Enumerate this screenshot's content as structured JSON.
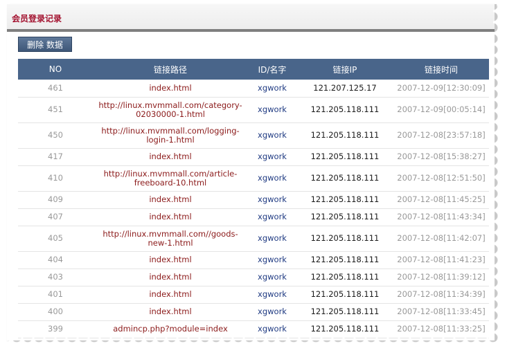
{
  "page": {
    "title": "会员登录记录",
    "delete_button": "删除 数据"
  },
  "table": {
    "headers": [
      "NO",
      "链接路径",
      "ID/名字",
      "链接IP",
      "链接时间"
    ],
    "rows": [
      {
        "no": "461",
        "path": "index.html",
        "name": "xgwork",
        "ip": "121.207.125.17",
        "time": "2007-12-09[12:30:09]"
      },
      {
        "no": "451",
        "path": "http://linux.mvmmall.com/category-02030000-1.html",
        "name": "xgwork",
        "ip": "121.205.118.111",
        "time": "2007-12-09[00:05:14]"
      },
      {
        "no": "450",
        "path": "http://linux.mvmmall.com/logging-login-1.html",
        "name": "xgwork",
        "ip": "121.205.118.111",
        "time": "2007-12-08[23:57:18]"
      },
      {
        "no": "417",
        "path": "index.html",
        "name": "xgwork",
        "ip": "121.205.118.111",
        "time": "2007-12-08[15:38:27]"
      },
      {
        "no": "410",
        "path": "http://linux.mvmmall.com/article-freeboard-10.html",
        "name": "xgwork",
        "ip": "121.205.118.111",
        "time": "2007-12-08[12:51:50]"
      },
      {
        "no": "409",
        "path": "index.html",
        "name": "xgwork",
        "ip": "121.205.118.111",
        "time": "2007-12-08[11:45:25]"
      },
      {
        "no": "407",
        "path": "index.html",
        "name": "xgwork",
        "ip": "121.205.118.111",
        "time": "2007-12-08[11:43:34]"
      },
      {
        "no": "405",
        "path": "http://linux.mvmmall.com//goods-new-1.html",
        "name": "xgwork",
        "ip": "121.205.118.111",
        "time": "2007-12-08[11:42:07]"
      },
      {
        "no": "404",
        "path": "index.html",
        "name": "xgwork",
        "ip": "121.205.118.111",
        "time": "2007-12-08[11:41:23]"
      },
      {
        "no": "403",
        "path": "index.html",
        "name": "xgwork",
        "ip": "121.205.118.111",
        "time": "2007-12-08[11:39:12]"
      },
      {
        "no": "401",
        "path": "index.html",
        "name": "xgwork",
        "ip": "121.205.118.111",
        "time": "2007-12-08[11:34:39]"
      },
      {
        "no": "400",
        "path": "index.html",
        "name": "xgwork",
        "ip": "121.205.118.111",
        "time": "2007-12-08[11:33:45]"
      },
      {
        "no": "399",
        "path": "admincp.php?module=index",
        "name": "xgwork",
        "ip": "121.205.118.111",
        "time": "2007-12-08[11:33:25]"
      }
    ]
  },
  "colors": {
    "title": "#a3122f",
    "header_bg": "#49658a",
    "path_text": "#8b1a1a",
    "name_text": "#1f3a82"
  }
}
